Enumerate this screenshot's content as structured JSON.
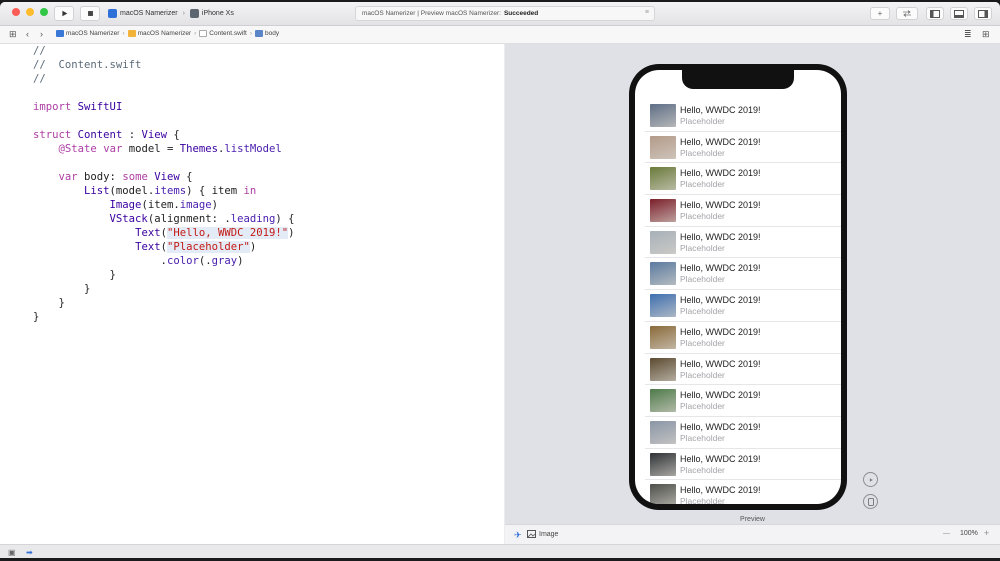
{
  "toolbar": {
    "run_icon": "play-icon",
    "stop_icon": "stop-square-icon",
    "scheme_name": "macOS Namerizer",
    "device_name": "iPhone Xs",
    "activity_text": "macOS Namerizer | Preview macOS Namerizer:",
    "activity_status": "Succeeded",
    "add_label": "+"
  },
  "jumpbar": {
    "crumbs": [
      "macOS Namerizer",
      "macOS Namerizer",
      "Content.swift",
      "body"
    ]
  },
  "code": {
    "lines": [
      "//",
      "//  Content.swift",
      "//",
      "",
      "import SwiftUI",
      "",
      "struct Content : View {",
      "    @State var model = Themes.listModel",
      "",
      "    var body: some View {",
      "        List(model.items) { item in",
      "            Image(item.image)",
      "            VStack(alignment: .leading) {",
      "                Text(\"Hello, WWDC 2019!\")",
      "                Text(\"Placeholder\")",
      "                    .color(.gray)",
      "            }",
      "        }",
      "    }",
      "}"
    ]
  },
  "preview": {
    "label": "Preview",
    "rows": [
      {
        "title": "Hello, WWDC 2019!",
        "subtitle": "Placeholder",
        "thumb": "#5e6e86"
      },
      {
        "title": "Hello, WWDC 2019!",
        "subtitle": "Placeholder",
        "thumb": "#b39a89"
      },
      {
        "title": "Hello, WWDC 2019!",
        "subtitle": "Placeholder",
        "thumb": "#6a7a3b"
      },
      {
        "title": "Hello, WWDC 2019!",
        "subtitle": "Placeholder",
        "thumb": "#7b1f2a"
      },
      {
        "title": "Hello, WWDC 2019!",
        "subtitle": "Placeholder",
        "thumb": "#a7b0b8"
      },
      {
        "title": "Hello, WWDC 2019!",
        "subtitle": "Placeholder",
        "thumb": "#5a7aa0"
      },
      {
        "title": "Hello, WWDC 2019!",
        "subtitle": "Placeholder",
        "thumb": "#3e6fb0"
      },
      {
        "title": "Hello, WWDC 2019!",
        "subtitle": "Placeholder",
        "thumb": "#8a6a3a"
      },
      {
        "title": "Hello, WWDC 2019!",
        "subtitle": "Placeholder",
        "thumb": "#5b4a30"
      },
      {
        "title": "Hello, WWDC 2019!",
        "subtitle": "Placeholder",
        "thumb": "#4e7a4a"
      },
      {
        "title": "Hello, WWDC 2019!",
        "subtitle": "Placeholder",
        "thumb": "#8a95a6"
      },
      {
        "title": "Hello, WWDC 2019!",
        "subtitle": "Placeholder",
        "thumb": "#2e3236"
      },
      {
        "title": "Hello, WWDC 2019!",
        "subtitle": "Placeholder",
        "thumb": "#4d4f4a"
      }
    ]
  },
  "canvas_bar": {
    "item_label": "Image",
    "zoom": "100%",
    "zoom_out": "—",
    "zoom_in": "+"
  }
}
